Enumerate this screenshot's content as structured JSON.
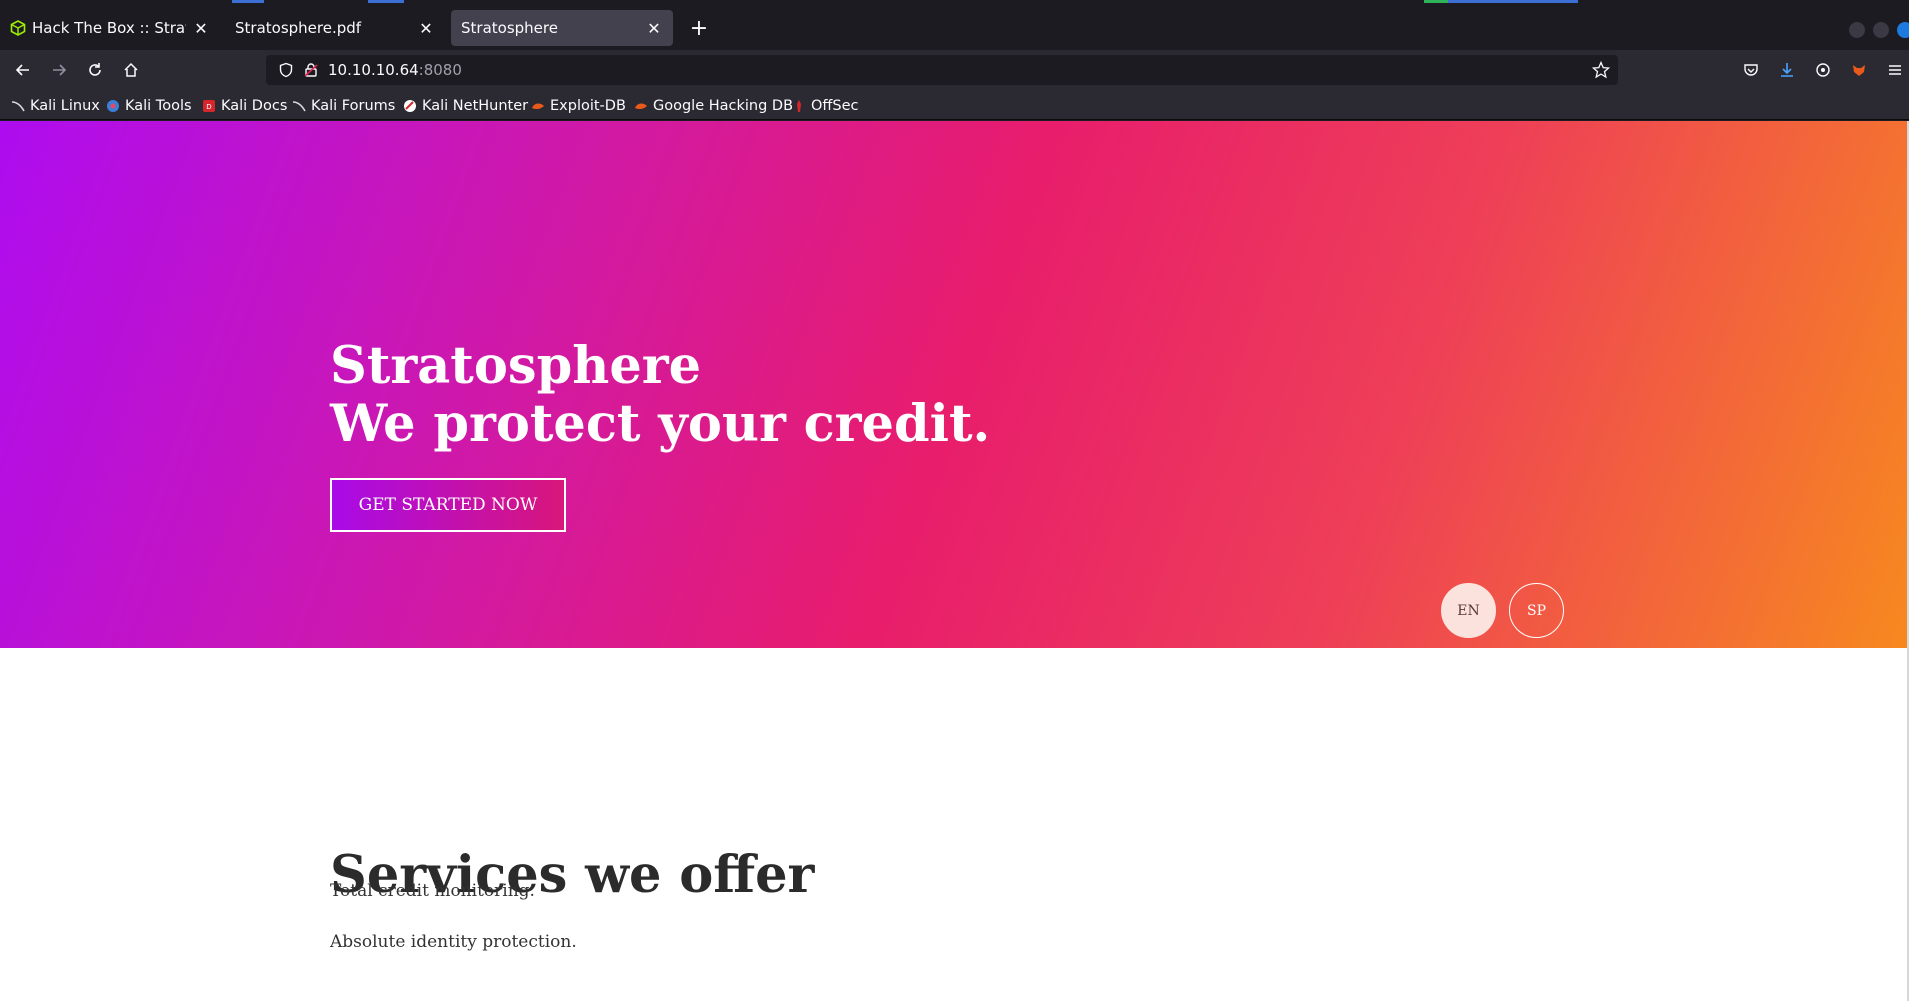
{
  "browser": {
    "tabs": [
      {
        "title": "Hack The Box :: Stratosphere",
        "active": false
      },
      {
        "title": "Stratosphere.pdf",
        "active": false
      },
      {
        "title": "Stratosphere",
        "active": true
      }
    ],
    "url_host": "10.10.10.64",
    "url_port": ":8080",
    "bookmarks": [
      {
        "label": "Kali Linux",
        "icon": "kali-dragon-icon"
      },
      {
        "label": "Kali Tools",
        "icon": "kali-tools-icon"
      },
      {
        "label": "Kali Docs",
        "icon": "kali-docs-icon"
      },
      {
        "label": "Kali Forums",
        "icon": "kali-dragon-icon"
      },
      {
        "label": "Kali NetHunter",
        "icon": "nethunter-icon"
      },
      {
        "label": "Exploit-DB",
        "icon": "exploit-db-icon"
      },
      {
        "label": "Google Hacking DB",
        "icon": "ghdb-icon"
      },
      {
        "label": "OffSec",
        "icon": "offsec-icon"
      }
    ],
    "accent_color": "#1f7ae0"
  },
  "page": {
    "hero_title_line1": "Stratosphere",
    "hero_title_line2": "We protect your credit.",
    "cta_label": "GET STARTED NOW",
    "lang_en": "EN",
    "lang_sp": "SP",
    "services_title": "Services we offer",
    "services": [
      "Total credit monitoring.",
      "Absolute identity protection."
    ],
    "gradient_colors": [
      "#ae0cf0",
      "#e81d6c",
      "#f7891f"
    ]
  }
}
